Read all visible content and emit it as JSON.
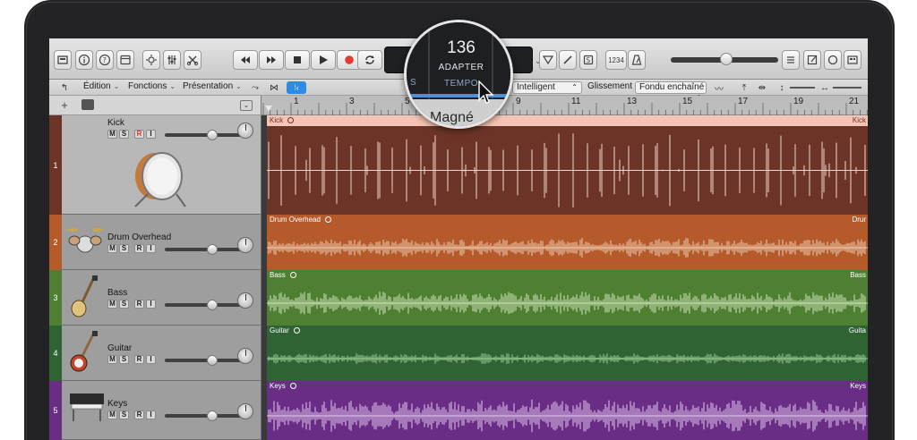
{
  "control_bar": {
    "icons": [
      "library-icon",
      "info-icon",
      "help-icon",
      "toolbar-icon",
      "smart-controls-icon",
      "mixer-icon",
      "editors-icon"
    ],
    "transport": [
      "rewind-icon",
      "fast-forward-icon",
      "stop-icon",
      "play-icon",
      "record-icon",
      "cycle-icon"
    ],
    "right_icons": [
      "tuner-icon",
      "pencil-icon",
      "solo-icon",
      "count-in-label",
      "metronome-icon"
    ],
    "count_in": "1234",
    "tempo": "136",
    "tempo_mode": "ADAPTER",
    "tempo_label": "TEMPO",
    "edge_letter": "S"
  },
  "menu_bar": {
    "edit": "Édition",
    "functions": "Fonctions",
    "view": "Présentation",
    "snap_value": "Intelligent",
    "drag_label": "Glissement :",
    "drag_value": "Fondu enchaîné",
    "snap_label_magnified": "Magné"
  },
  "ruler": {
    "bars": [
      "1",
      "3",
      "5",
      "9",
      "11",
      "13",
      "15",
      "17",
      "19",
      "21"
    ]
  },
  "tracks": [
    {
      "number": "1",
      "name": "Kick",
      "region": "Kick",
      "color": "#6b3426",
      "region_top": "#f6c4b4",
      "wave_color": "#f3d5cc",
      "instrument": "kick-drum"
    },
    {
      "number": "2",
      "name": "Drum Overhead",
      "region": "Drum Overhead",
      "region_end": "Drur",
      "color": "#b55a2a",
      "region_top": "#b55a2a",
      "wave_color": "#f0cdb3",
      "instrument": "drum-kit"
    },
    {
      "number": "3",
      "name": "Bass",
      "region": "Bass",
      "region_end": "Bass",
      "color": "#4f7f33",
      "region_top": "#4f7f33",
      "wave_color": "#cfe7bb",
      "instrument": "bass-guitar"
    },
    {
      "number": "4",
      "name": "Guitar",
      "region": "Guitar",
      "region_end": "Guita",
      "color": "#2f6334",
      "region_top": "#2f6334",
      "wave_color": "#9fcf99",
      "instrument": "electric-guitar"
    },
    {
      "number": "5",
      "name": "Keys",
      "region": "Keys",
      "region_end": "Keys",
      "color": "#6a2d86",
      "region_top": "#6a2d86",
      "wave_color": "#e2c7ee",
      "instrument": "electric-piano"
    }
  ],
  "track_buttons": {
    "mute": "M",
    "solo": "S",
    "record": "R",
    "input": "I"
  },
  "kick_region_end": "Kick"
}
